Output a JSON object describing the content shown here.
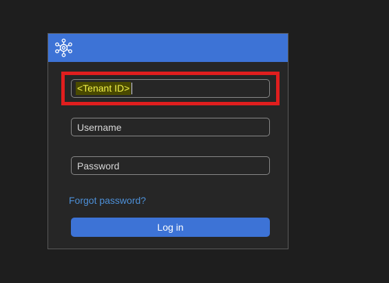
{
  "header": {
    "logo_icon": "network-hub-icon",
    "color": "#3d73d6"
  },
  "form": {
    "tenant": {
      "value": "<Tenant ID>",
      "highlighted": true
    },
    "username": {
      "placeholder": "Username"
    },
    "password": {
      "placeholder": "Password"
    },
    "forgot_link": "Forgot password?",
    "login_button": "Log in"
  },
  "colors": {
    "accent": "#3d73d6",
    "link": "#4d90d8",
    "highlight_border": "#e01e1e",
    "background": "#1e1e1e",
    "card": "#262626"
  }
}
